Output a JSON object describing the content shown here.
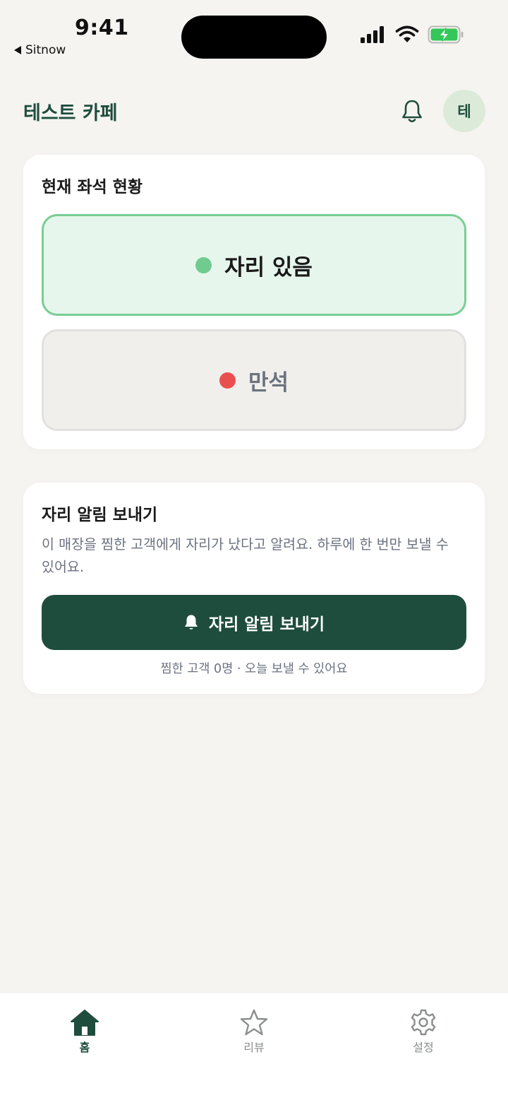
{
  "status_bar": {
    "time": "9:41",
    "back_app": "Sitnow",
    "icons": [
      "signal-icon",
      "wifi-icon",
      "battery-charging-icon"
    ],
    "battery_color": "#34c759"
  },
  "header": {
    "title": "테스트 카페",
    "avatar_initial": "테",
    "icons": [
      "bell-icon"
    ]
  },
  "seat_card": {
    "title": "현재 좌석 현황",
    "options": [
      {
        "label": "자리 있음",
        "selected": true,
        "dot_color": "#6fcb8f",
        "text_color": "#1a1a1a"
      },
      {
        "label": "만석",
        "selected": false,
        "dot_color": "#ea4f4f",
        "text_color": "#6b7280"
      }
    ]
  },
  "alert_card": {
    "title": "자리 알림 보내기",
    "description": "이 매장을 찜한 고객에게 자리가 났다고 알려요. 하루에 한 번만 보낼 수 있어요.",
    "button_label": "자리 알림 보내기",
    "meta": "찜한 고객 0명 · 오늘 보낼 수 있어요"
  },
  "tabbar": {
    "items": [
      {
        "label": "홈",
        "icon": "home-icon",
        "active": true
      },
      {
        "label": "리뷰",
        "icon": "star-icon",
        "active": false
      },
      {
        "label": "설정",
        "icon": "gear-icon",
        "active": false
      }
    ]
  },
  "colors": {
    "brand": "#1f4d3d",
    "background": "#f5f4f0",
    "available_border": "#79cd94",
    "available_bg": "#e7f6ec"
  }
}
